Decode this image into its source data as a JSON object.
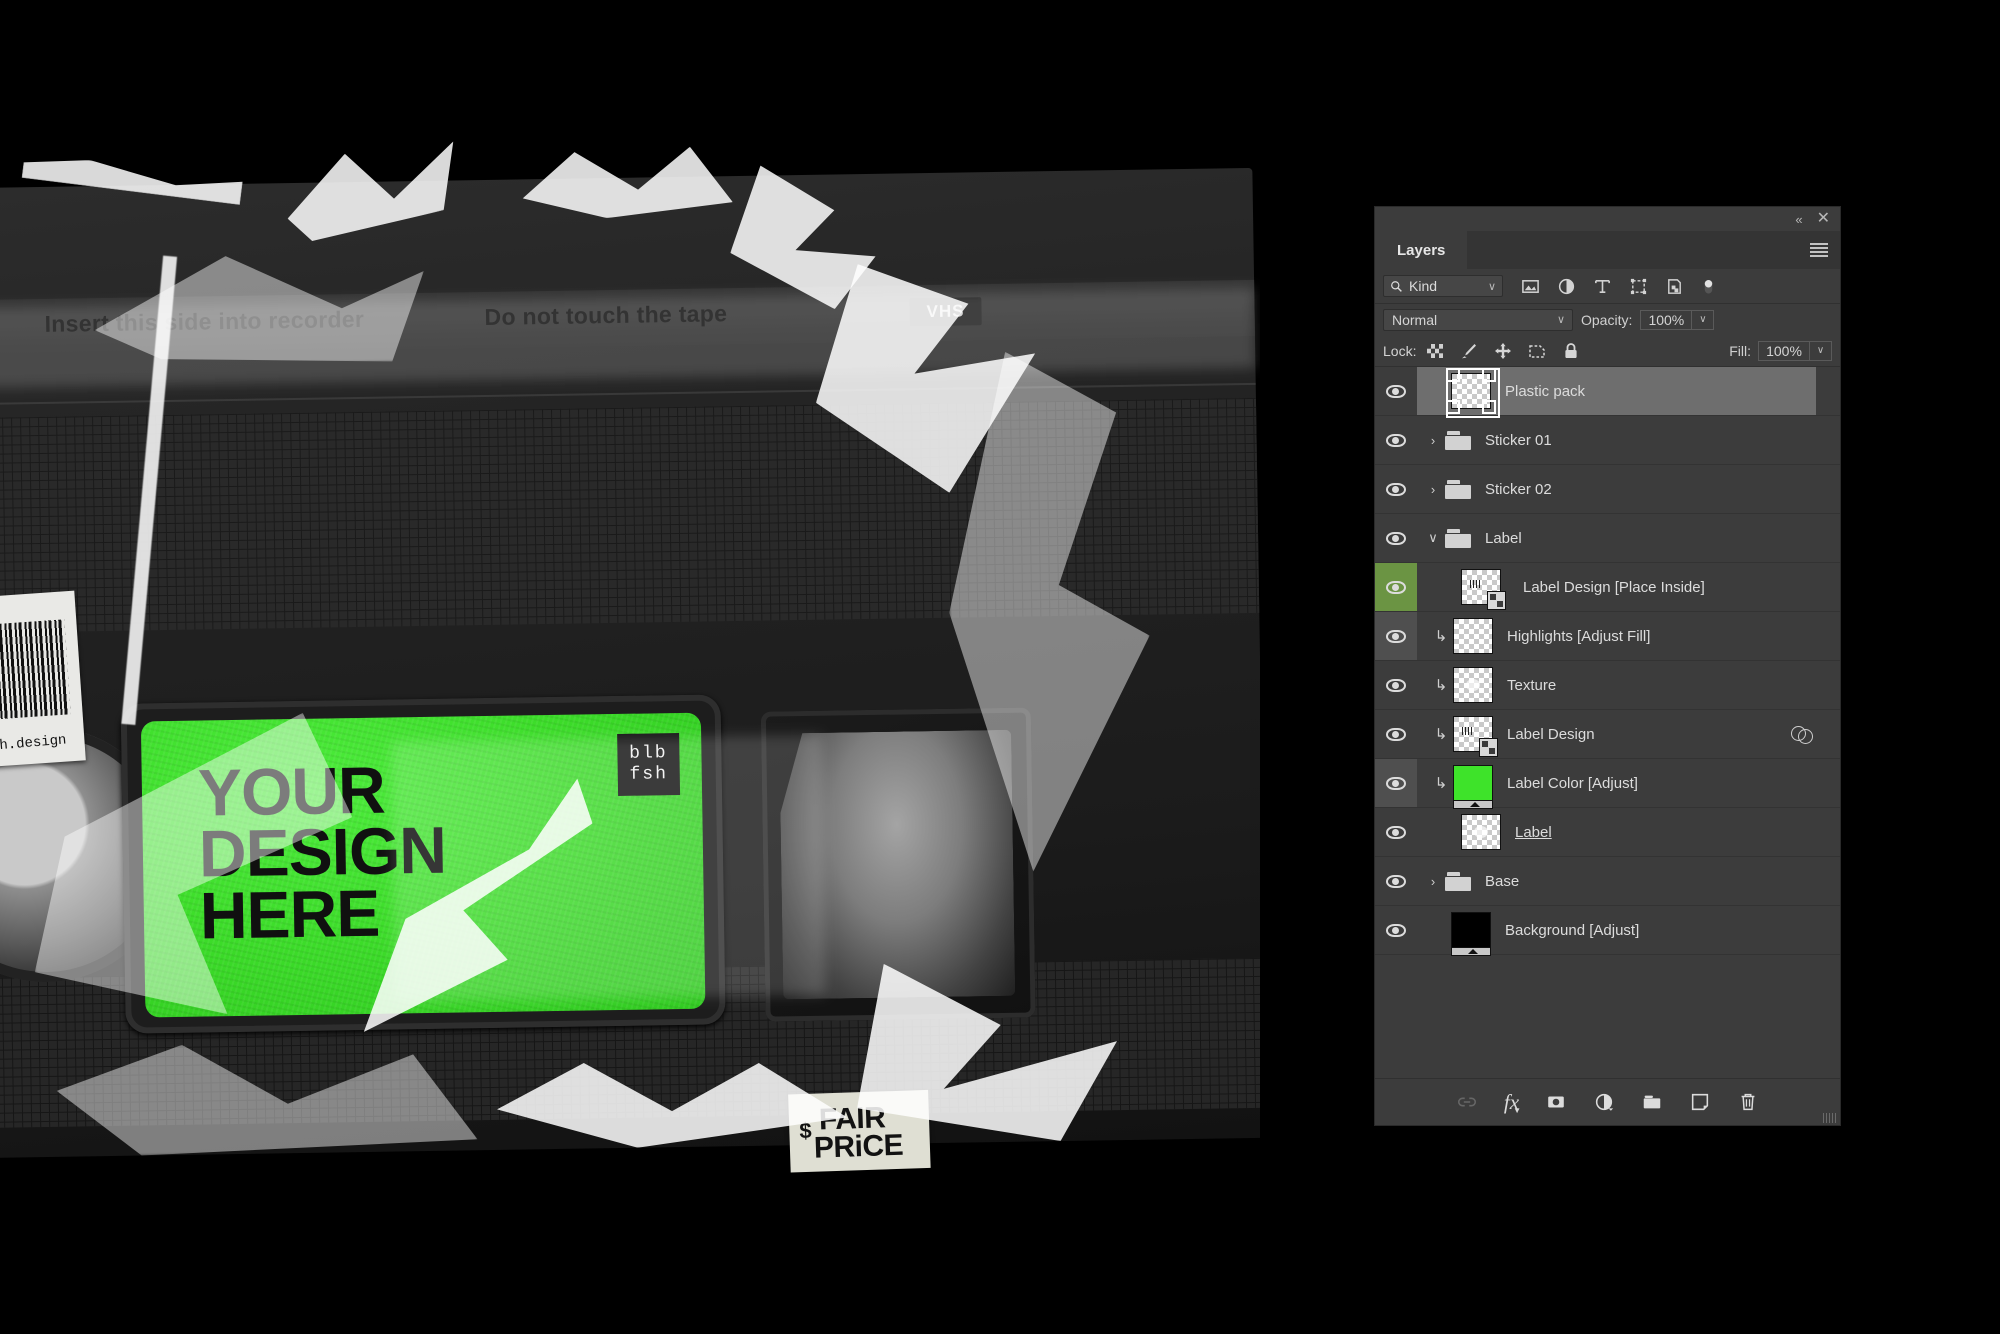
{
  "artwork": {
    "top_band_left": "Insert this side into recorder",
    "top_band_right": "Do not touch the tape",
    "vhs_logo": "VHS",
    "barcode_caption": "bulbfish.design",
    "label_text": "YOUR\nDESIGN\nHERE",
    "label_logo": "blb\nfsh",
    "label_color": "#3ee32a",
    "sticker_price": {
      "currency": "$",
      "line1": "FAIR",
      "line2": "PRiCE"
    }
  },
  "panel": {
    "window_controls": {
      "collapse": "«",
      "close": "✕"
    },
    "tab_label": "Layers",
    "menu_icon": "hamburger-icon",
    "filter": {
      "kind_label": "Kind",
      "search_icon": "search-icon",
      "chevron": "∨",
      "icons": [
        "pixel-layer-filter-icon",
        "adjustment-layer-filter-icon",
        "type-layer-filter-icon",
        "shape-layer-filter-icon",
        "smart-object-filter-icon",
        "filter-toggle-switch"
      ]
    },
    "blend": {
      "mode": "Normal",
      "chevron": "∨",
      "opacity_label": "Opacity:",
      "opacity_value": "100%"
    },
    "lock": {
      "label": "Lock:",
      "icons": [
        "lock-transparent-pixels-icon",
        "lock-image-pixels-icon",
        "lock-position-icon",
        "lock-artboard-nesting-icon",
        "lock-all-icon"
      ],
      "fill_label": "Fill:",
      "fill_value": "100%"
    },
    "layers": [
      {
        "name": "Plastic pack",
        "visible": true,
        "type": "pixel",
        "selected": true,
        "indent": 0,
        "thumb": "transparent"
      },
      {
        "name": "Sticker 01",
        "visible": true,
        "type": "group",
        "expanded": false,
        "indent": 0,
        "chevron": "›"
      },
      {
        "name": "Sticker 02",
        "visible": true,
        "type": "group",
        "expanded": false,
        "indent": 0,
        "chevron": "›"
      },
      {
        "name": "Label",
        "visible": true,
        "type": "group",
        "expanded": true,
        "indent": 0,
        "chevron": "∨"
      },
      {
        "name": "Label Design [Place Inside]",
        "visible": true,
        "type": "smart-object",
        "indent": 1,
        "thumb": "transparent",
        "eye_highlight": "#6b9443"
      },
      {
        "name": "Highlights [Adjust Fill]",
        "visible": true,
        "type": "pixel",
        "indent": 1,
        "clipped": true,
        "thumb": "transparent",
        "row_shade": true
      },
      {
        "name": "Texture",
        "visible": true,
        "type": "pixel",
        "indent": 1,
        "clipped": true,
        "thumb": "transparent"
      },
      {
        "name": "Label Design",
        "visible": true,
        "type": "smart-object",
        "indent": 1,
        "clipped": true,
        "thumb": "transparent",
        "has_effects": true,
        "effects_chevron": "∨"
      },
      {
        "name": "Label Color [Adjust]",
        "visible": true,
        "type": "adjustment",
        "indent": 1,
        "clipped": true,
        "thumb": "green",
        "row_shade": true
      },
      {
        "name": "Label",
        "visible": true,
        "type": "pixel",
        "indent": 1,
        "thumb": "transparent",
        "underlined": true
      },
      {
        "name": "Base",
        "visible": true,
        "type": "group",
        "expanded": false,
        "indent": 0,
        "chevron": "›"
      },
      {
        "name": "Background [Adjust]",
        "visible": true,
        "type": "adjustment",
        "indent": 0,
        "thumb": "black"
      }
    ],
    "bottom_bar_icons": [
      "link-layers-icon",
      "add-layer-style-fx-icon",
      "add-layer-mask-icon",
      "new-adjustment-layer-icon",
      "new-group-icon",
      "new-layer-icon",
      "delete-layer-icon"
    ],
    "bottom_fx_label": "fx"
  }
}
